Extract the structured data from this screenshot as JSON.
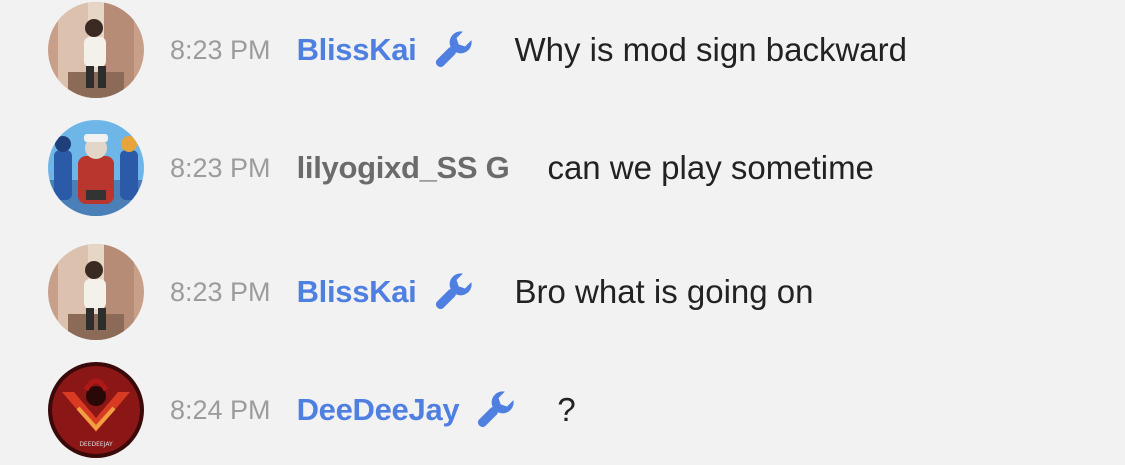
{
  "colors": {
    "background": "#f2f2f2",
    "moderator_name": "#4f80e1",
    "regular_name": "#6b6b6b",
    "timestamp": "#9c9c9c",
    "message_text": "#222222",
    "mod_badge": "#4f80e1"
  },
  "messages": [
    {
      "time": "8:23 PM",
      "username": "BlissKai",
      "moderator": true,
      "badge_icon": "wrench-icon",
      "text": "Why is mod sign backward"
    },
    {
      "time": "8:23 PM",
      "username": "lilyogixd_SS G",
      "moderator": false,
      "text": "can we play sometime"
    },
    {
      "time": "8:23 PM",
      "username": "BlissKai",
      "moderator": true,
      "badge_icon": "wrench-icon",
      "text": "Bro what is going on"
    },
    {
      "time": "8:24 PM",
      "username": "DeeDeeJay",
      "moderator": true,
      "badge_icon": "wrench-icon",
      "text": "?",
      "avatar_logo_text": "DEEDEEJAY"
    }
  ]
}
